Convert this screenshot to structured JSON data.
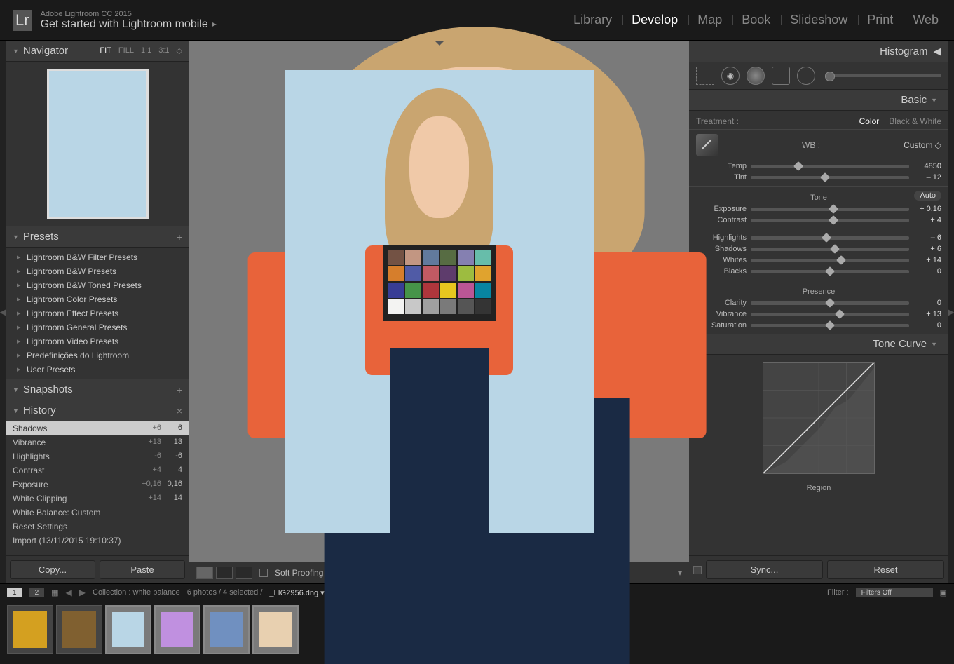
{
  "header": {
    "app_name": "Adobe Lightroom CC 2015",
    "get_started": "Get started with Lightroom mobile",
    "logo": "Lr"
  },
  "modules": [
    "Library",
    "Develop",
    "Map",
    "Book",
    "Slideshow",
    "Print",
    "Web"
  ],
  "active_module": "Develop",
  "navigator": {
    "title": "Navigator",
    "options": [
      "FIT",
      "FILL",
      "1:1",
      "3:1"
    ],
    "active_option": "FIT"
  },
  "presets": {
    "title": "Presets",
    "items": [
      "Lightroom B&W Filter Presets",
      "Lightroom B&W Presets",
      "Lightroom B&W Toned Presets",
      "Lightroom Color Presets",
      "Lightroom Effect Presets",
      "Lightroom General Presets",
      "Lightroom Video Presets",
      "Predefinições do Lightroom",
      "User Presets"
    ]
  },
  "snapshots": {
    "title": "Snapshots"
  },
  "history": {
    "title": "History",
    "items": [
      {
        "name": "Shadows",
        "delta": "+6",
        "val": "6",
        "active": true
      },
      {
        "name": "Vibrance",
        "delta": "+13",
        "val": "13"
      },
      {
        "name": "Highlights",
        "delta": "-6",
        "val": "-6"
      },
      {
        "name": "Contrast",
        "delta": "+4",
        "val": "4"
      },
      {
        "name": "Exposure",
        "delta": "+0,16",
        "val": "0,16"
      },
      {
        "name": "White Clipping",
        "delta": "+14",
        "val": "14"
      },
      {
        "name": "White Balance: Custom",
        "delta": "",
        "val": ""
      },
      {
        "name": "Reset Settings",
        "delta": "",
        "val": ""
      },
      {
        "name": "Import (13/11/2015 19:10:37)",
        "delta": "",
        "val": ""
      }
    ]
  },
  "buttons": {
    "copy": "Copy...",
    "paste": "Paste",
    "sync": "Sync...",
    "reset": "Reset"
  },
  "soft_proofing": "Soft Proofing",
  "histogram_title": "Histogram",
  "basic": {
    "title": "Basic",
    "treatment_label": "Treatment :",
    "color": "Color",
    "bw": "Black & White",
    "wb_label": "WB :",
    "wb_value": "Custom",
    "tone_label": "Tone",
    "auto": "Auto",
    "presence_label": "Presence",
    "sliders": {
      "temp": {
        "label": "Temp",
        "val": "4850",
        "pos": 30
      },
      "tint": {
        "label": "Tint",
        "val": "– 12",
        "pos": 47
      },
      "exposure": {
        "label": "Exposure",
        "val": "+ 0,16",
        "pos": 52
      },
      "contrast": {
        "label": "Contrast",
        "val": "+ 4",
        "pos": 52
      },
      "highlights": {
        "label": "Highlights",
        "val": "– 6",
        "pos": 48
      },
      "shadows": {
        "label": "Shadows",
        "val": "+ 6",
        "pos": 53
      },
      "whites": {
        "label": "Whites",
        "val": "+ 14",
        "pos": 57
      },
      "blacks": {
        "label": "Blacks",
        "val": "0",
        "pos": 50
      },
      "clarity": {
        "label": "Clarity",
        "val": "0",
        "pos": 50
      },
      "vibrance": {
        "label": "Vibrance",
        "val": "+ 13",
        "pos": 56
      },
      "saturation": {
        "label": "Saturation",
        "val": "0",
        "pos": 50
      }
    }
  },
  "tone_curve_title": "Tone Curve",
  "region_label": "Region",
  "filter_bar": {
    "pages": [
      "1",
      "2"
    ],
    "collection": "Collection : white balance",
    "count": "6 photos / 4 selected /",
    "filename": "_LIG2956.dng",
    "filter_label": "Filter :",
    "filter_value": "Filters Off"
  },
  "color_checker": [
    "#735244",
    "#c29682",
    "#627a9d",
    "#576c43",
    "#8580b1",
    "#67bdaa",
    "#d67e2c",
    "#505ba6",
    "#c15a63",
    "#5e3c6c",
    "#9dbc40",
    "#e0a32e",
    "#383d96",
    "#469449",
    "#af363c",
    "#e7c71f",
    "#bb5695",
    "#0885a1",
    "#f3f3f2",
    "#c8c8c8",
    "#a0a0a0",
    "#7a7a7a",
    "#555555",
    "#343434"
  ]
}
